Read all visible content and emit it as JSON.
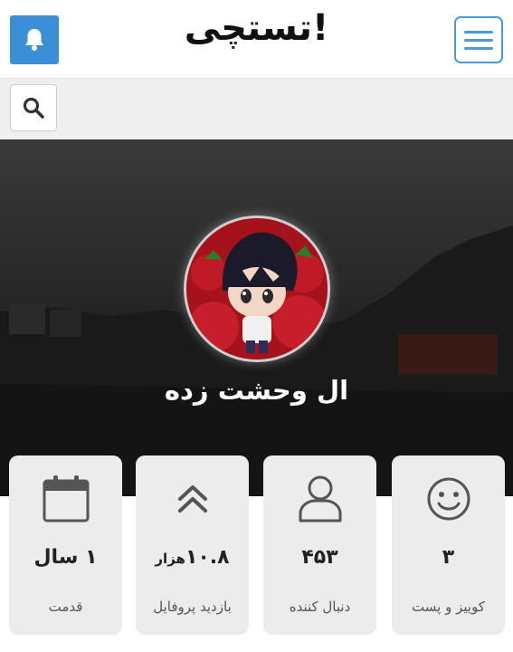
{
  "header": {
    "logo_text": "تستچی!",
    "notification_icon": "bell-icon",
    "menu_icon": "hamburger-icon",
    "accent_color": "#3a8fd6"
  },
  "search": {
    "icon": "search-icon"
  },
  "profile": {
    "name": "ال وحشت زده",
    "avatar_icon": "avatar-image"
  },
  "stats": [
    {
      "icon": "calendar-icon",
      "value": "۱ سال",
      "unit": "",
      "label": "قدمت"
    },
    {
      "icon": "double-chevron-up-icon",
      "value": "۱۰.۸",
      "unit": "هزار",
      "label": "بازدید پروفایل"
    },
    {
      "icon": "user-icon",
      "value": "۴۵۳",
      "unit": "",
      "label": "دنبال کننده"
    },
    {
      "icon": "smiley-icon",
      "value": "۳",
      "unit": "",
      "label": "کوییز و پست"
    }
  ]
}
